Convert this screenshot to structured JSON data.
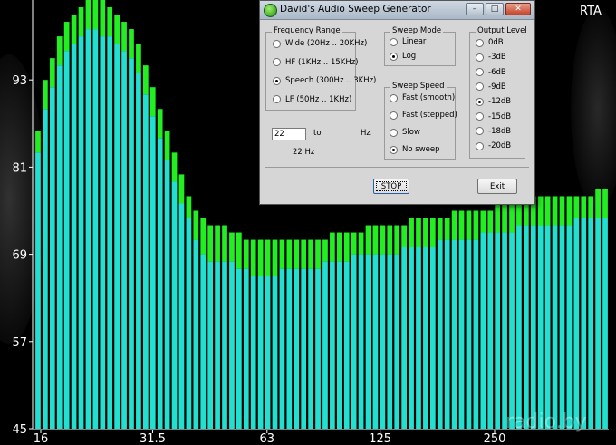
{
  "rta": {
    "label": "RTA",
    "y_ticks": [
      "45",
      "57",
      "69",
      "81",
      "93"
    ],
    "x_ticks": [
      "16",
      "31.5",
      "63",
      "125",
      "250"
    ],
    "watermark": "radio.by",
    "colors": {
      "bar_avg": "#22e0d0",
      "bar_peak": "#22ee22",
      "background": "#000000"
    }
  },
  "chart_data": {
    "type": "bar",
    "title": "RTA",
    "xlabel": "",
    "ylabel": "",
    "x_scale": "log",
    "ylim": [
      45,
      104
    ],
    "x_tick_labels": [
      "16",
      "31.5",
      "63",
      "125",
      "250"
    ],
    "y_tick_labels": [
      "45",
      "57",
      "69",
      "81",
      "93"
    ],
    "series": [
      {
        "color": "#22e0d0",
        "values": [
          83,
          89,
          92,
          95,
          97,
          98,
          99,
          100,
          100,
          99,
          99,
          98,
          97,
          96,
          94,
          91,
          88,
          85,
          82,
          79,
          76,
          74,
          71,
          69,
          68,
          68,
          68,
          68,
          67,
          67,
          66,
          66,
          66,
          66,
          67,
          67,
          67,
          67,
          67,
          67,
          68,
          68,
          68,
          68,
          69,
          69,
          69,
          69,
          69,
          69,
          69,
          70,
          70,
          70,
          70,
          70,
          71,
          71,
          71,
          71,
          71,
          71,
          72,
          72,
          72,
          72,
          72,
          73,
          73,
          73,
          73,
          73,
          73,
          73,
          73,
          74,
          74,
          74,
          74,
          74
        ]
      },
      {
        "color": "#22ee22",
        "values": [
          86,
          93,
          96,
          99,
          101,
          102,
          103,
          104,
          104,
          104,
          103,
          102,
          101,
          100,
          98,
          95,
          92,
          89,
          86,
          83,
          80,
          77,
          75,
          74,
          73,
          73,
          73,
          72,
          72,
          71,
          71,
          71,
          71,
          71,
          71,
          71,
          71,
          71,
          71,
          71,
          71,
          72,
          72,
          72,
          72,
          72,
          73,
          73,
          73,
          73,
          73,
          73,
          74,
          74,
          74,
          74,
          74,
          74,
          75,
          75,
          75,
          75,
          75,
          75,
          76,
          76,
          76,
          76,
          76,
          77,
          77,
          77,
          77,
          77,
          77,
          77,
          77,
          77,
          78,
          78
        ]
      }
    ]
  },
  "dialog": {
    "title": "David's Audio Sweep Generator",
    "frequency_range": {
      "title": "Frequency Range",
      "options": [
        "Wide  (20Hz .. 20KHz)",
        "HF  (1KHz .. 15KHz)",
        "Speech  (300Hz .. 3KHz)",
        "LF  (50Hz .. 1KHz)"
      ],
      "selected": 2
    },
    "sweep_mode": {
      "title": "Sweep Mode",
      "options": [
        "Linear",
        "Log"
      ],
      "selected": 1
    },
    "sweep_speed": {
      "title": "Sweep Speed",
      "options": [
        "Fast (smooth)",
        "Fast (stepped)",
        "Slow",
        "No sweep"
      ],
      "selected": 3
    },
    "output_level": {
      "title": "Output Level",
      "options": [
        "0dB",
        "-3dB",
        "-6dB",
        "-9dB",
        "-12dB",
        "-15dB",
        "-18dB",
        "-20dB"
      ],
      "selected": 4
    },
    "freq_value": "22",
    "to_label": "to",
    "hz_label": "Hz",
    "freq_readout": "22 Hz",
    "stop_label": "STOP",
    "exit_label": "Exit"
  }
}
